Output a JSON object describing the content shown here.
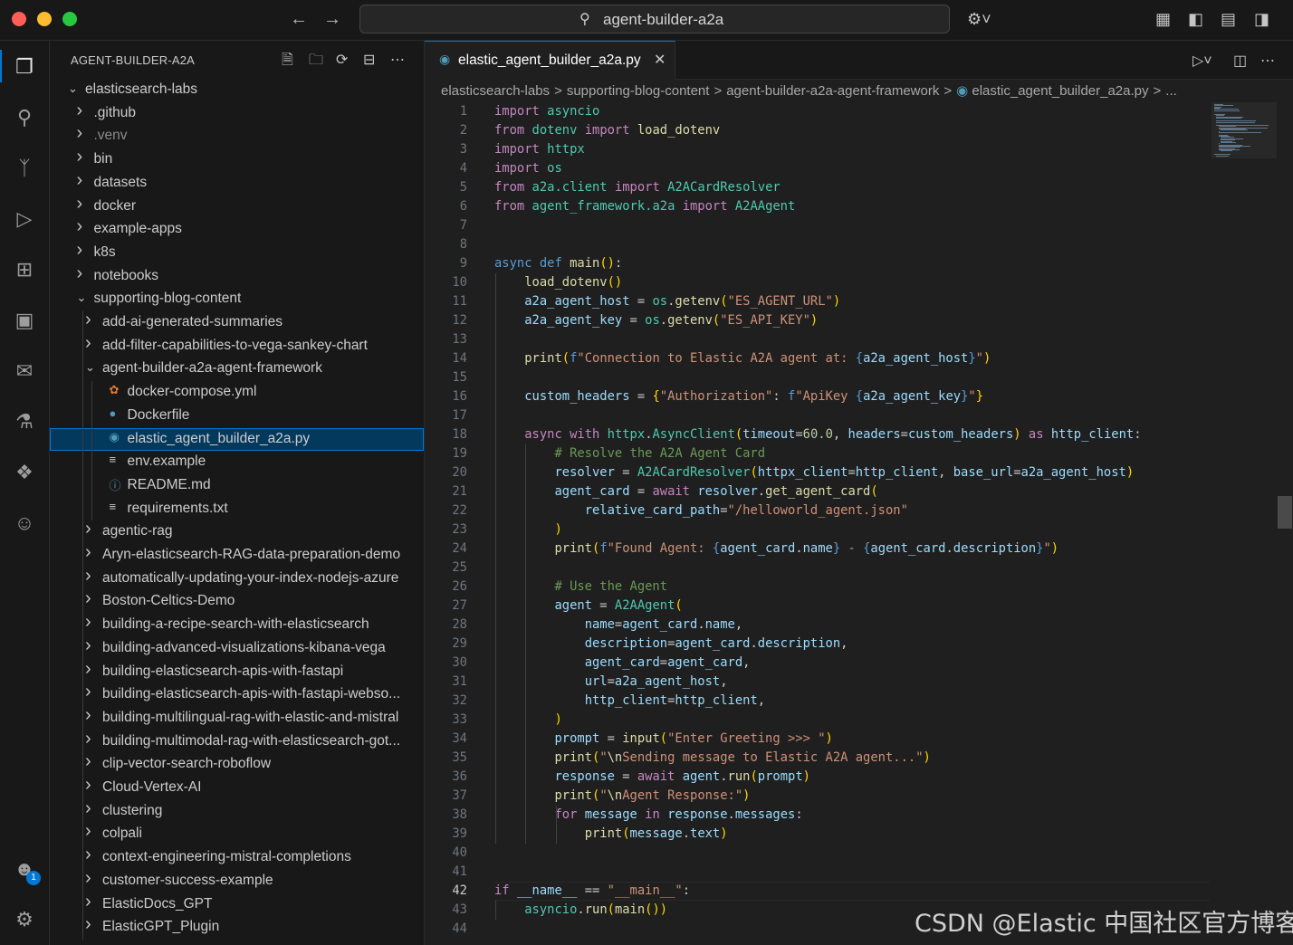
{
  "window": {
    "search_text": "agent-builder-a2a",
    "back_icon": "←",
    "forward_icon": "→"
  },
  "sidebar": {
    "title": "AGENT-BUILDER-A2A",
    "rows": [
      {
        "label": "elasticsearch-labs",
        "depth": 0,
        "type": "folder",
        "open": true
      },
      {
        "label": ".github",
        "depth": 1,
        "type": "folder",
        "open": false
      },
      {
        "label": ".venv",
        "depth": 1,
        "type": "folder",
        "open": false,
        "dim": true
      },
      {
        "label": "bin",
        "depth": 1,
        "type": "folder",
        "open": false
      },
      {
        "label": "datasets",
        "depth": 1,
        "type": "folder",
        "open": false
      },
      {
        "label": "docker",
        "depth": 1,
        "type": "folder",
        "open": false
      },
      {
        "label": "example-apps",
        "depth": 1,
        "type": "folder",
        "open": false
      },
      {
        "label": "k8s",
        "depth": 1,
        "type": "folder",
        "open": false
      },
      {
        "label": "notebooks",
        "depth": 1,
        "type": "folder",
        "open": false
      },
      {
        "label": "supporting-blog-content",
        "depth": 1,
        "type": "folder",
        "open": true
      },
      {
        "label": "add-ai-generated-summaries",
        "depth": 2,
        "type": "folder",
        "open": false
      },
      {
        "label": "add-filter-capabilities-to-vega-sankey-chart",
        "depth": 2,
        "type": "folder",
        "open": false
      },
      {
        "label": "agent-builder-a2a-agent-framework",
        "depth": 2,
        "type": "folder",
        "open": true
      },
      {
        "label": "docker-compose.yml",
        "depth": 3,
        "type": "file",
        "icon": "yml"
      },
      {
        "label": "Dockerfile",
        "depth": 3,
        "type": "file",
        "icon": "docker"
      },
      {
        "label": "elastic_agent_builder_a2a.py",
        "depth": 3,
        "type": "file",
        "icon": "py",
        "selected": true
      },
      {
        "label": "env.example",
        "depth": 3,
        "type": "file",
        "icon": "txt"
      },
      {
        "label": "README.md",
        "depth": 3,
        "type": "file",
        "icon": "info"
      },
      {
        "label": "requirements.txt",
        "depth": 3,
        "type": "file",
        "icon": "txt"
      },
      {
        "label": "agentic-rag",
        "depth": 2,
        "type": "folder",
        "open": false
      },
      {
        "label": "Aryn-elasticsearch-RAG-data-preparation-demo",
        "depth": 2,
        "type": "folder",
        "open": false
      },
      {
        "label": "automatically-updating-your-index-nodejs-azure",
        "depth": 2,
        "type": "folder",
        "open": false
      },
      {
        "label": "Boston-Celtics-Demo",
        "depth": 2,
        "type": "folder",
        "open": false
      },
      {
        "label": "building-a-recipe-search-with-elasticsearch",
        "depth": 2,
        "type": "folder",
        "open": false
      },
      {
        "label": "building-advanced-visualizations-kibana-vega",
        "depth": 2,
        "type": "folder",
        "open": false
      },
      {
        "label": "building-elasticsearch-apis-with-fastapi",
        "depth": 2,
        "type": "folder",
        "open": false
      },
      {
        "label": "building-elasticsearch-apis-with-fastapi-webso...",
        "depth": 2,
        "type": "folder",
        "open": false
      },
      {
        "label": "building-multilingual-rag-with-elastic-and-mistral",
        "depth": 2,
        "type": "folder",
        "open": false
      },
      {
        "label": "building-multimodal-rag-with-elasticsearch-got...",
        "depth": 2,
        "type": "folder",
        "open": false
      },
      {
        "label": "clip-vector-search-roboflow",
        "depth": 2,
        "type": "folder",
        "open": false
      },
      {
        "label": "Cloud-Vertex-AI",
        "depth": 2,
        "type": "folder",
        "open": false
      },
      {
        "label": "clustering",
        "depth": 2,
        "type": "folder",
        "open": false
      },
      {
        "label": "colpali",
        "depth": 2,
        "type": "folder",
        "open": false
      },
      {
        "label": "context-engineering-mistral-completions",
        "depth": 2,
        "type": "folder",
        "open": false
      },
      {
        "label": "customer-success-example",
        "depth": 2,
        "type": "folder",
        "open": false
      },
      {
        "label": "ElasticDocs_GPT",
        "depth": 2,
        "type": "folder",
        "open": false
      },
      {
        "label": "ElasticGPT_Plugin",
        "depth": 2,
        "type": "folder",
        "open": false
      }
    ]
  },
  "editor": {
    "tab_label": "elastic_agent_builder_a2a.py",
    "breadcrumbs": [
      "elasticsearch-labs",
      "supporting-blog-content",
      "agent-builder-a2a-agent-framework",
      "elastic_agent_builder_a2a.py",
      "..."
    ],
    "current_line": 42,
    "lines": [
      "<span class='kc'>import</span> <span class='t'>asyncio</span>",
      "<span class='kc'>from</span> <span class='t'>dotenv</span> <span class='kc'>import</span> <span class='f'>load_dotenv</span>",
      "<span class='kc'>import</span> <span class='t'>httpx</span>",
      "<span class='kc'>import</span> <span class='t'>os</span>",
      "<span class='kc'>from</span> <span class='t'>a2a.client</span> <span class='kc'>import</span> <span class='t'>A2ACardResolver</span>",
      "<span class='kc'>from</span> <span class='t'>agent_framework.a2a</span> <span class='kc'>import</span> <span class='t'>A2AAgent</span>",
      "",
      "",
      "<span class='k'>async</span> <span class='k'>def</span> <span class='f'>main</span><span class='p'>()</span>:",
      "    <span class='f'>load_dotenv</span><span class='p'>()</span>",
      "    <span class='v'>a2a_agent_host</span> = <span class='t'>os</span>.<span class='f'>getenv</span><span class='p'>(</span><span class='s'>\"ES_AGENT_URL\"</span><span class='p'>)</span>",
      "    <span class='v'>a2a_agent_key</span> = <span class='t'>os</span>.<span class='f'>getenv</span><span class='p'>(</span><span class='s'>\"ES_API_KEY\"</span><span class='p'>)</span>",
      "",
      "    <span class='f'>print</span><span class='p'>(</span><span class='k'>f</span><span class='s'>\"Connection to Elastic A2A agent at: </span><span class='k'>{</span><span class='v'>a2a_agent_host</span><span class='k'>}</span><span class='s'>\"</span><span class='p'>)</span>",
      "",
      "    <span class='v'>custom_headers</span> = <span class='p'>{</span><span class='s'>\"Authorization\"</span>: <span class='k'>f</span><span class='s'>\"ApiKey </span><span class='k'>{</span><span class='v'>a2a_agent_key</span><span class='k'>}</span><span class='s'>\"</span><span class='p'>}</span>",
      "",
      "    <span class='kc'>async</span> <span class='kc'>with</span> <span class='t'>httpx</span>.<span class='t'>AsyncClient</span><span class='p'>(</span><span class='v'>timeout</span>=<span class='n'>60.0</span>, <span class='v'>headers</span>=<span class='v'>custom_headers</span><span class='p'>)</span> <span class='kc'>as</span> <span class='v'>http_client</span>:",
      "        <span class='c'># Resolve the A2A Agent Card</span>",
      "        <span class='v'>resolver</span> = <span class='t'>A2ACardResolver</span><span class='p'>(</span><span class='v'>httpx_client</span>=<span class='v'>http_client</span>, <span class='v'>base_url</span>=<span class='v'>a2a_agent_host</span><span class='p'>)</span>",
      "        <span class='v'>agent_card</span> = <span class='kc'>await</span> <span class='v'>resolver</span>.<span class='f'>get_agent_card</span><span class='p'>(</span>",
      "            <span class='v'>relative_card_path</span>=<span class='s'>\"/helloworld_agent.json\"</span>",
      "        <span class='p'>)</span>",
      "        <span class='f'>print</span><span class='p'>(</span><span class='k'>f</span><span class='s'>\"Found Agent: </span><span class='k'>{</span><span class='v'>agent_card</span>.<span class='v'>name</span><span class='k'>}</span><span class='s'> - </span><span class='k'>{</span><span class='v'>agent_card</span>.<span class='v'>description</span><span class='k'>}</span><span class='s'>\"</span><span class='p'>)</span>",
      "",
      "        <span class='c'># Use the Agent</span>",
      "        <span class='v'>agent</span> = <span class='t'>A2AAgent</span><span class='p'>(</span>",
      "            <span class='v'>name</span>=<span class='v'>agent_card</span>.<span class='v'>name</span>,",
      "            <span class='v'>description</span>=<span class='v'>agent_card</span>.<span class='v'>description</span>,",
      "            <span class='v'>agent_card</span>=<span class='v'>agent_card</span>,",
      "            <span class='v'>url</span>=<span class='v'>a2a_agent_host</span>,",
      "            <span class='v'>http_client</span>=<span class='v'>http_client</span>,",
      "        <span class='p'>)</span>",
      "        <span class='v'>prompt</span> = <span class='f'>input</span><span class='p'>(</span><span class='s'>\"Enter Greeting >>> \"</span><span class='p'>)</span>",
      "        <span class='f'>print</span><span class='p'>(</span><span class='s'>\"</span><span class='f'>\\n</span><span class='s'>Sending message to Elastic A2A agent...\"</span><span class='p'>)</span>",
      "        <span class='v'>response</span> = <span class='kc'>await</span> <span class='v'>agent</span>.<span class='f'>run</span><span class='p'>(</span><span class='v'>prompt</span><span class='p'>)</span>",
      "        <span class='f'>print</span><span class='p'>(</span><span class='s'>\"</span><span class='f'>\\n</span><span class='s'>Agent Response:\"</span><span class='p'>)</span>",
      "        <span class='kc'>for</span> <span class='v'>message</span> <span class='kc'>in</span> <span class='v'>response</span>.<span class='v'>messages</span>:",
      "            <span class='f'>print</span><span class='p'>(</span><span class='v'>message</span>.<span class='v'>text</span><span class='p'>)</span>",
      "",
      "",
      "<span class='kc'>if</span> <span class='v'>__name__</span> == <span class='s'>\"__main__\"</span>:",
      "    <span class='t'>asyncio</span>.<span class='f'>run</span><span class='p'>(</span><span class='f'>main</span><span class='p'>())</span>",
      ""
    ]
  },
  "watermark": "CSDN @Elastic 中国社区官方博客"
}
